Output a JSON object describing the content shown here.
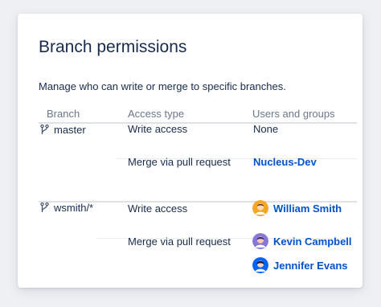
{
  "panel": {
    "title": "Branch permissions",
    "subtitle": "Manage who can write or merge to specific branches."
  },
  "table": {
    "headers": {
      "branch": "Branch",
      "access": "Access type",
      "users": "Users and groups"
    },
    "groups": [
      {
        "branch": "master",
        "rules": [
          {
            "access": "Write access",
            "users": [
              {
                "text": "None",
                "is_link": false
              }
            ]
          },
          {
            "access": "Merge via pull request",
            "users": [
              {
                "text": "Nucleus-Dev",
                "is_link": true
              }
            ]
          }
        ]
      },
      {
        "branch": "wsmith/*",
        "rules": [
          {
            "access": "Write access",
            "users": [
              {
                "text": "William Smith",
                "is_link": true,
                "avatar_color": "#f5a623"
              }
            ]
          },
          {
            "access": "Merge via pull request",
            "users": [
              {
                "text": "Kevin Campbell",
                "is_link": true,
                "avatar_color": "#8777d9"
              },
              {
                "text": "Jennifer Evans",
                "is_link": true,
                "avatar_color": "#0065ff"
              }
            ]
          }
        ]
      }
    ]
  },
  "colors": {
    "link": "#0052cc",
    "text": "#172b4d",
    "muted": "#6b778c",
    "divider": "#dfe1e6"
  },
  "icons": {
    "branch": "branch-icon"
  }
}
